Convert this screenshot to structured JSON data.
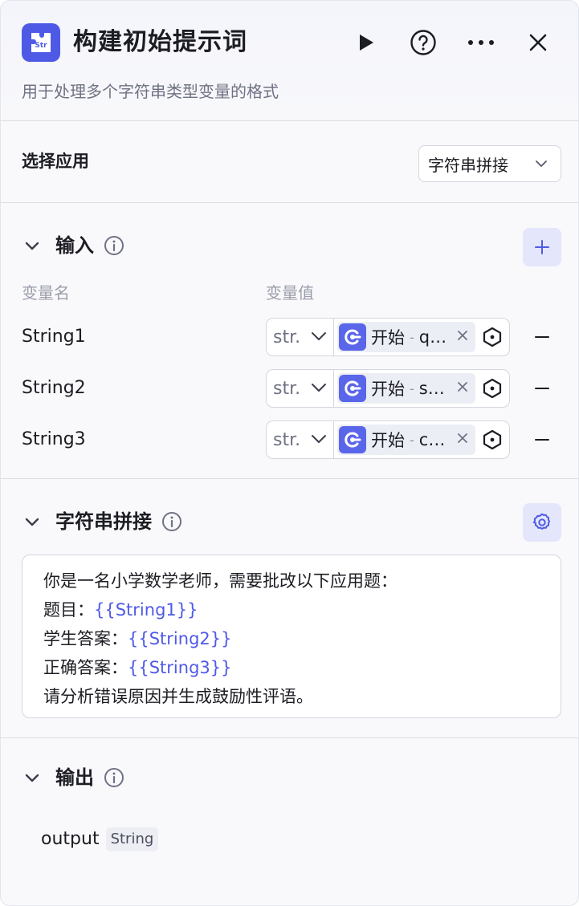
{
  "header": {
    "title": "构建初始提示词",
    "icon_text": "Str",
    "subtitle": "用于处理多个字符串类型变量的格式",
    "actions": [
      "play-icon",
      "help-icon",
      "more-icon",
      "close-icon"
    ]
  },
  "select_app": {
    "label": "选择应用",
    "value": "字符串拼接"
  },
  "input_section": {
    "title": "输入",
    "columns": {
      "name": "变量名",
      "value": "变量值"
    },
    "rows": [
      {
        "name": "String1",
        "type": "str.",
        "node": "开始",
        "sep": "-",
        "var": "q…"
      },
      {
        "name": "String2",
        "type": "str.",
        "node": "开始",
        "sep": "-",
        "var": "s…"
      },
      {
        "name": "String3",
        "type": "str.",
        "node": "开始",
        "sep": "-",
        "var": "c…"
      }
    ]
  },
  "concat_section": {
    "title": "字符串拼接",
    "lines": [
      {
        "text": "你是一名小学数学老师，需要批改以下应用题：",
        "var": ""
      },
      {
        "text": "题目：",
        "var": "{{String1}}"
      },
      {
        "text": "学生答案：",
        "var": "{{String2}}"
      },
      {
        "text": "正确答案：",
        "var": "{{String3}}"
      },
      {
        "text": "请分析错误原因并生成鼓励性评语。",
        "var": ""
      }
    ]
  },
  "output_section": {
    "title": "输出",
    "name": "output",
    "type": "String"
  },
  "colors": {
    "accent": "#4e5ae6",
    "accent_light": "#e4e6fb",
    "border": "#d4d6de",
    "muted": "#9a9dab"
  }
}
